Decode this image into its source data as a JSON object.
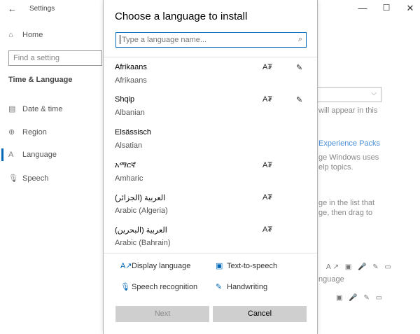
{
  "settings_window": {
    "title": "Settings",
    "find_placeholder": "Find a setting",
    "home_label": "Home",
    "section_title": "Time & Language",
    "nav": [
      {
        "label": "Date & time",
        "icon": "calendar-icon"
      },
      {
        "label": "Region",
        "icon": "globe-icon"
      },
      {
        "label": "Language",
        "icon": "language-icon"
      },
      {
        "label": "Speech",
        "icon": "microphone-icon"
      }
    ],
    "right_fragments": {
      "appear": "will appear in this",
      "packs": "Experience Packs",
      "windows_uses": "ge Windows uses",
      "help": "elp topics.",
      "in_list": "ge in the list that",
      "drag": "ge, then drag to",
      "language_word": "nguage"
    }
  },
  "dialog": {
    "title": "Choose a language to install",
    "search_placeholder": "Type a language name...",
    "languages": [
      {
        "native": "Afrikaans",
        "english": "Afrikaans",
        "features": [
          "display-language-icon",
          "handwriting-icon"
        ]
      },
      {
        "native": "Shqip",
        "english": "Albanian",
        "features": [
          "display-language-icon",
          "handwriting-icon"
        ]
      },
      {
        "native": "Elsässisch",
        "english": "Alsatian",
        "features": []
      },
      {
        "native": "አማርኛ",
        "english": "Amharic",
        "features": [
          "display-language-icon"
        ]
      },
      {
        "native": "العربية (الجزائر)",
        "english": "Arabic (Algeria)",
        "features": [
          "display-language-icon"
        ]
      },
      {
        "native": "العربية (البحرين)",
        "english": "Arabic (Bahrain)",
        "features": [
          "display-language-icon"
        ]
      }
    ],
    "legend": {
      "display_language": "Display language",
      "text_to_speech": "Text-to-speech",
      "speech_recognition": "Speech recognition",
      "handwriting": "Handwriting"
    },
    "buttons": {
      "next": "Next",
      "cancel": "Cancel"
    }
  },
  "colors": {
    "accent": "#0067b8",
    "button_bg": "#cfcfcf",
    "link": "#4a90d9"
  }
}
